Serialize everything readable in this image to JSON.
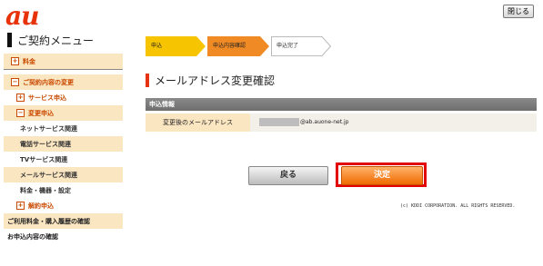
{
  "brand": {
    "logo_text": "au",
    "logo_color": "#e8320a",
    "accent": "#f28c00"
  },
  "header": {
    "close_label": "閉じる"
  },
  "sidebar": {
    "title": "ご契約メニュー",
    "items": [
      {
        "label": "料金",
        "icon": "plus-box-icon"
      },
      {
        "label": "ご契約内容の変更",
        "icon": "minus-box-icon"
      },
      {
        "label": "サービス申込",
        "icon": "plus-box-icon"
      },
      {
        "label": "変更申込",
        "icon": "minus-box-icon"
      },
      {
        "label": "ネットサービス関連"
      },
      {
        "label": "電話サービス関連"
      },
      {
        "label": "TVサービス関連"
      },
      {
        "label": "メールサービス関連"
      },
      {
        "label": "料金・機器・設定"
      },
      {
        "label": "解約申込",
        "icon": "plus-box-icon"
      },
      {
        "label": "ご利用料金・購入履歴の確認"
      },
      {
        "label": "お申込内容の確認"
      }
    ]
  },
  "steps": [
    {
      "label": "申込",
      "state": "done"
    },
    {
      "label": "申込内容確認",
      "state": "current"
    },
    {
      "label": "申込完了",
      "state": "pending"
    }
  ],
  "page": {
    "title": "メールアドレス変更確認"
  },
  "info": {
    "section_label": "申込情報",
    "row_label": "変更後のメールアドレス",
    "row_value": "@ab.auone-net.jp"
  },
  "buttons": {
    "back_label": "戻る",
    "confirm_label": "決定"
  },
  "footer": {
    "copyright": "(c) KDDI CORPORATION. ALL RIGHTS RESERVED."
  }
}
